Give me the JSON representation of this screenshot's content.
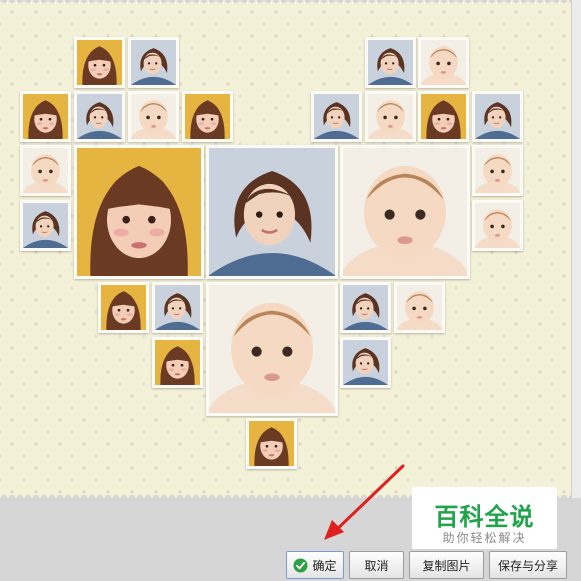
{
  "canvas": {
    "background_color": "#f4f1d9",
    "layout": "heart",
    "photos": [
      {
        "subject": "girl-bangs",
        "bg": "#e6b440"
      },
      {
        "subject": "woman-denim",
        "bg": "#c9d2dc"
      },
      {
        "subject": "woman-denim",
        "bg": "#c9d2dc"
      },
      {
        "subject": "baby",
        "bg": "#f3eee6"
      },
      {
        "subject": "girl-bangs",
        "bg": "#e6b440"
      },
      {
        "subject": "woman-denim",
        "bg": "#c9d2dc"
      },
      {
        "subject": "baby",
        "bg": "#f3eee6"
      },
      {
        "subject": "girl-bangs",
        "bg": "#e6b440"
      },
      {
        "subject": "woman-denim",
        "bg": "#c9d2dc"
      },
      {
        "subject": "baby",
        "bg": "#f3eee6"
      },
      {
        "subject": "girl-bangs",
        "bg": "#e6b440"
      },
      {
        "subject": "woman-denim",
        "bg": "#c9d2dc"
      },
      {
        "subject": "baby",
        "bg": "#f3eee6"
      },
      {
        "subject": "girl-bangs",
        "bg": "#e6b440"
      },
      {
        "subject": "woman-denim",
        "bg": "#c9d2dc"
      },
      {
        "subject": "baby",
        "bg": "#f3eee6"
      },
      {
        "subject": "baby",
        "bg": "#f3eee6"
      },
      {
        "subject": "woman-denim",
        "bg": "#c9d2dc"
      },
      {
        "subject": "baby",
        "bg": "#f3eee6"
      },
      {
        "subject": "girl-bangs",
        "bg": "#e6b440"
      },
      {
        "subject": "woman-denim",
        "bg": "#c9d2dc"
      },
      {
        "subject": "baby",
        "bg": "#f3eee6"
      },
      {
        "subject": "woman-denim",
        "bg": "#c9d2dc"
      },
      {
        "subject": "baby",
        "bg": "#f3eee6"
      },
      {
        "subject": "girl-bangs",
        "bg": "#e6b440"
      },
      {
        "subject": "woman-denim",
        "bg": "#c9d2dc"
      },
      {
        "subject": "girl-bangs",
        "bg": "#e6b440"
      },
      {
        "subject": "baby",
        "bg": "#f3eee6"
      }
    ]
  },
  "watermark": {
    "title": "百科全说",
    "subtitle": "助你轻松解决",
    "title_color": "#1fa44a"
  },
  "annotation_arrow": {
    "color": "#e02020",
    "points_to": "ok-button"
  },
  "buttons": {
    "ok": "确定",
    "cancel": "取消",
    "copy": "复制图片",
    "save_share": "保存与分享"
  },
  "icons": {
    "ok": "green-check-circle-icon"
  }
}
